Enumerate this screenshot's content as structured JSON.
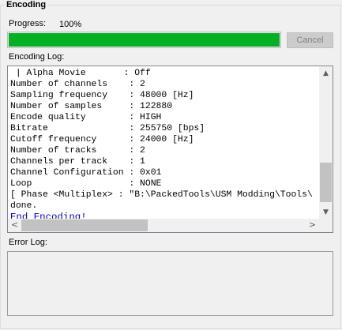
{
  "group": {
    "title": "Encoding"
  },
  "progress": {
    "label": "Progress:",
    "percent_text": "100%",
    "value": 1.0,
    "color": "#06b025"
  },
  "cancel_button": {
    "label": "Cancel",
    "enabled": false
  },
  "encoding_log": {
    "label": "Encoding Log:",
    "lines": [
      " | Alpha Movie       : Off",
      "Number of channels    : 2",
      "Sampling frequency    : 48000 [Hz]",
      "Number of samples     : 122880",
      "Encode quality        : HIGH",
      "Bitrate               : 255750 [bps]",
      "Cutoff frequency      : 24000 [Hz]",
      "Number of tracks      : 2",
      "Channels per track    : 1",
      "Channel Configuration : 0x01",
      "Loop                  : NONE",
      "[ Phase <Multiplex> : \"B:\\PackedTools\\USM Modding\\Tools\\",
      "done."
    ],
    "final_line": "End Encoding!",
    "final_line_color": "#0000d0"
  },
  "error_log": {
    "label": "Error Log:",
    "text": ""
  },
  "icons": {
    "scroll_up": "▲",
    "scroll_down": "▼",
    "scroll_left": "<",
    "scroll_right": ">"
  }
}
